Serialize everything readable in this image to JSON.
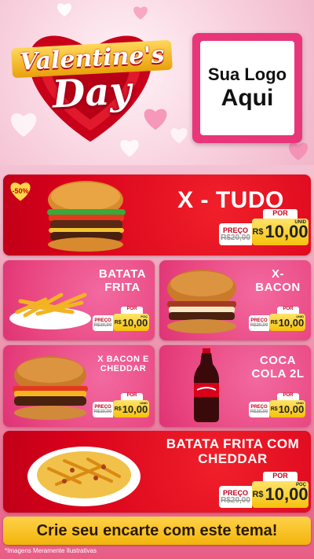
{
  "header": {
    "valentine": "Valentine's",
    "day": "Day",
    "logo_line1": "Sua Logo",
    "logo_line2": "Aqui"
  },
  "colors": {
    "red": "#d8001a",
    "pink": "#e9447f",
    "yellow": "#f5c10c"
  },
  "products": [
    {
      "name": "X - TUDO",
      "badge": "-50%",
      "preco_label": "PREÇO",
      "old": "R$20,00",
      "por": "POR",
      "currency": "R$",
      "price": "10,00",
      "unit": "UNID",
      "image": "burger-icon"
    },
    {
      "name_l1": "BATATA",
      "name_l2": "FRITA",
      "preco_label": "PREÇO",
      "old": "R$20,00",
      "por": "POR",
      "currency": "R$",
      "price": "10,00",
      "unit": "POÇ",
      "image": "fries-icon"
    },
    {
      "name_l1": "X-",
      "name_l2": "BACON",
      "preco_label": "PREÇO",
      "old": "R$20,00",
      "por": "POR",
      "currency": "R$",
      "price": "10,00",
      "unit": "UNID",
      "image": "burger-icon"
    },
    {
      "name_l1": "X BACON E",
      "name_l2": "CHEDDAR",
      "preco_label": "PREÇO",
      "old": "R$20,00",
      "por": "POR",
      "currency": "R$",
      "price": "10,00",
      "unit": "UNID",
      "image": "burger-icon"
    },
    {
      "name_l1": "COCA",
      "name_l2": "COLA 2L",
      "preco_label": "PREÇO",
      "old": "R$20,00",
      "por": "POR",
      "currency": "R$",
      "price": "10,00",
      "unit": "UNID",
      "image": "soda-bottle-icon"
    },
    {
      "name_l1": "BATATA FRITA COM",
      "name_l2": "CHEDDAR",
      "preco_label": "PREÇO",
      "old": "R$20,00",
      "por": "POR",
      "currency": "R$",
      "price": "10,00",
      "unit": "POÇ",
      "image": "fries-plate-icon"
    }
  ],
  "banner": "Crie seu encarte com este tema!",
  "disclaimer": "*Imagens Meramente Ilustrativas"
}
